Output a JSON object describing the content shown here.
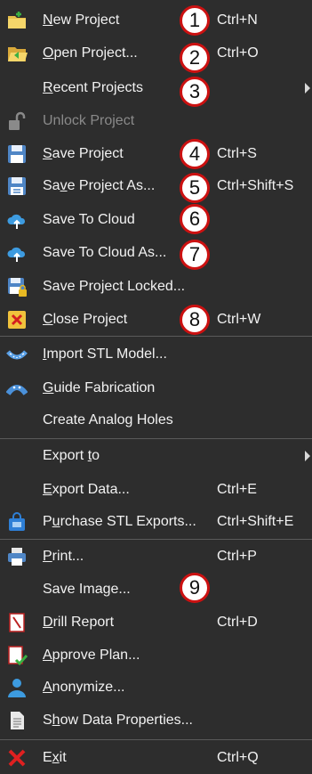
{
  "menu": {
    "items": [
      {
        "pre": "",
        "u": "N",
        "post": "ew Project",
        "shortcut": "Ctrl+N",
        "icon": "new-project-icon"
      },
      {
        "pre": "",
        "u": "O",
        "post": "pen Project...",
        "shortcut": "Ctrl+O",
        "icon": "open-project-icon"
      },
      {
        "pre": "",
        "u": "R",
        "post": "ecent Projects",
        "shortcut": "",
        "icon": ""
      },
      {
        "pre": "Unlock Project",
        "u": "",
        "post": "",
        "shortcut": "",
        "icon": "unlock-icon"
      },
      {
        "pre": "",
        "u": "S",
        "post": "ave Project",
        "shortcut": "Ctrl+S",
        "icon": "save-icon"
      },
      {
        "pre": "Sa",
        "u": "v",
        "post": "e Project As...",
        "shortcut": "Ctrl+Shift+S",
        "icon": "save-as-icon"
      },
      {
        "pre": "Save To Cloud",
        "u": "",
        "post": "",
        "shortcut": "",
        "icon": "cloud-upload-icon"
      },
      {
        "pre": "Save To Cloud As...",
        "u": "",
        "post": "",
        "shortcut": "",
        "icon": "cloud-upload-as-icon"
      },
      {
        "pre": "Save Project Locked...",
        "u": "",
        "post": "",
        "shortcut": "",
        "icon": "save-locked-icon"
      },
      {
        "pre": "",
        "u": "C",
        "post": "lose Project",
        "shortcut": "Ctrl+W",
        "icon": "close-project-icon"
      },
      {
        "pre": "",
        "u": "I",
        "post": "mport STL Model...",
        "shortcut": "",
        "icon": "import-stl-icon"
      },
      {
        "pre": "",
        "u": "G",
        "post": "uide Fabrication",
        "shortcut": "",
        "icon": "guide-fabrication-icon"
      },
      {
        "pre": "Create Analog Holes",
        "u": "",
        "post": "",
        "shortcut": "",
        "icon": ""
      },
      {
        "pre": "Export ",
        "u": "t",
        "post": "o",
        "shortcut": "",
        "icon": ""
      },
      {
        "pre": "",
        "u": "E",
        "post": "xport Data...",
        "shortcut": "Ctrl+E",
        "icon": ""
      },
      {
        "pre": "P",
        "u": "u",
        "post": "rchase STL Exports...",
        "shortcut": "Ctrl+Shift+E",
        "icon": "purchase-bag-icon"
      },
      {
        "pre": "",
        "u": "P",
        "post": "rint...",
        "shortcut": "Ctrl+P",
        "icon": "printer-icon"
      },
      {
        "pre": "Save Image...",
        "u": "",
        "post": "",
        "shortcut": "",
        "icon": ""
      },
      {
        "pre": "",
        "u": "D",
        "post": "rill Report",
        "shortcut": "Ctrl+D",
        "icon": "drill-report-icon"
      },
      {
        "pre": "",
        "u": "A",
        "post": "pprove Plan...",
        "shortcut": "",
        "icon": "approve-plan-icon"
      },
      {
        "pre": "",
        "u": "A",
        "post": "nonymize...",
        "shortcut": "",
        "icon": "user-icon"
      },
      {
        "pre": "S",
        "u": "h",
        "post": "ow Data Properties...",
        "shortcut": "",
        "icon": "document-icon"
      },
      {
        "pre": "E",
        "u": "x",
        "post": "it",
        "shortcut": "Ctrl+Q",
        "icon": "exit-icon"
      }
    ]
  },
  "badges": [
    "1",
    "2",
    "3",
    "4",
    "5",
    "6",
    "7",
    "8",
    "9"
  ],
  "colors": {
    "background": "#2d2d2d",
    "text": "#f2f2f2",
    "disabled_text": "#8a8a8a",
    "badge_border": "#cc1111"
  }
}
